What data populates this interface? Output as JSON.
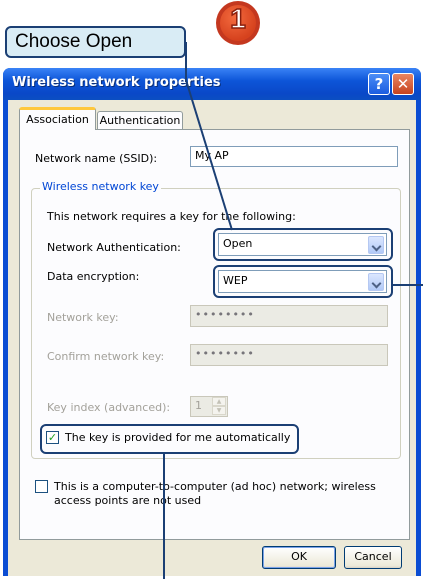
{
  "callouts": {
    "step_number": "1",
    "choose_open_label": "Choose Open"
  },
  "dialog": {
    "title": "Wireless network properties",
    "help_glyph": "?",
    "close_glyph": "✕",
    "tabs": [
      {
        "label": "Association",
        "active": true
      },
      {
        "label": "Authentication",
        "active": false
      }
    ],
    "ssid": {
      "label": "Network name (SSID):",
      "value": "My AP"
    },
    "key_group": {
      "legend": "Wireless network key",
      "description": "This network requires a key for the following:",
      "auth": {
        "label": "Network Authentication:",
        "value": "Open"
      },
      "encryption": {
        "label": "Data encryption:",
        "value": "WEP"
      },
      "network_key": {
        "label": "Network key:",
        "value": "••••••••"
      },
      "confirm_key": {
        "label": "Confirm network key:",
        "value": "••••••••"
      },
      "key_index": {
        "label": "Key index (advanced):",
        "value": "1"
      },
      "auto_key": {
        "label": "The key is provided for me automatically",
        "checked": true
      }
    },
    "adhoc": {
      "label_line1": "This is a computer-to-computer (ad hoc) network; wireless",
      "label_line2": "access points are not used",
      "checked": false
    },
    "ok_label": "OK",
    "cancel_label": "Cancel"
  },
  "colors": {
    "titlebar": "#0b4dd3",
    "callout_border": "#1b3f74",
    "callout_fill": "#d9ecf5",
    "badge": "#d6421e"
  },
  "icons": [
    "help-icon",
    "close-icon",
    "chevron-down-icon",
    "checkmark-icon",
    "spin-up-icon",
    "spin-down-icon"
  ]
}
